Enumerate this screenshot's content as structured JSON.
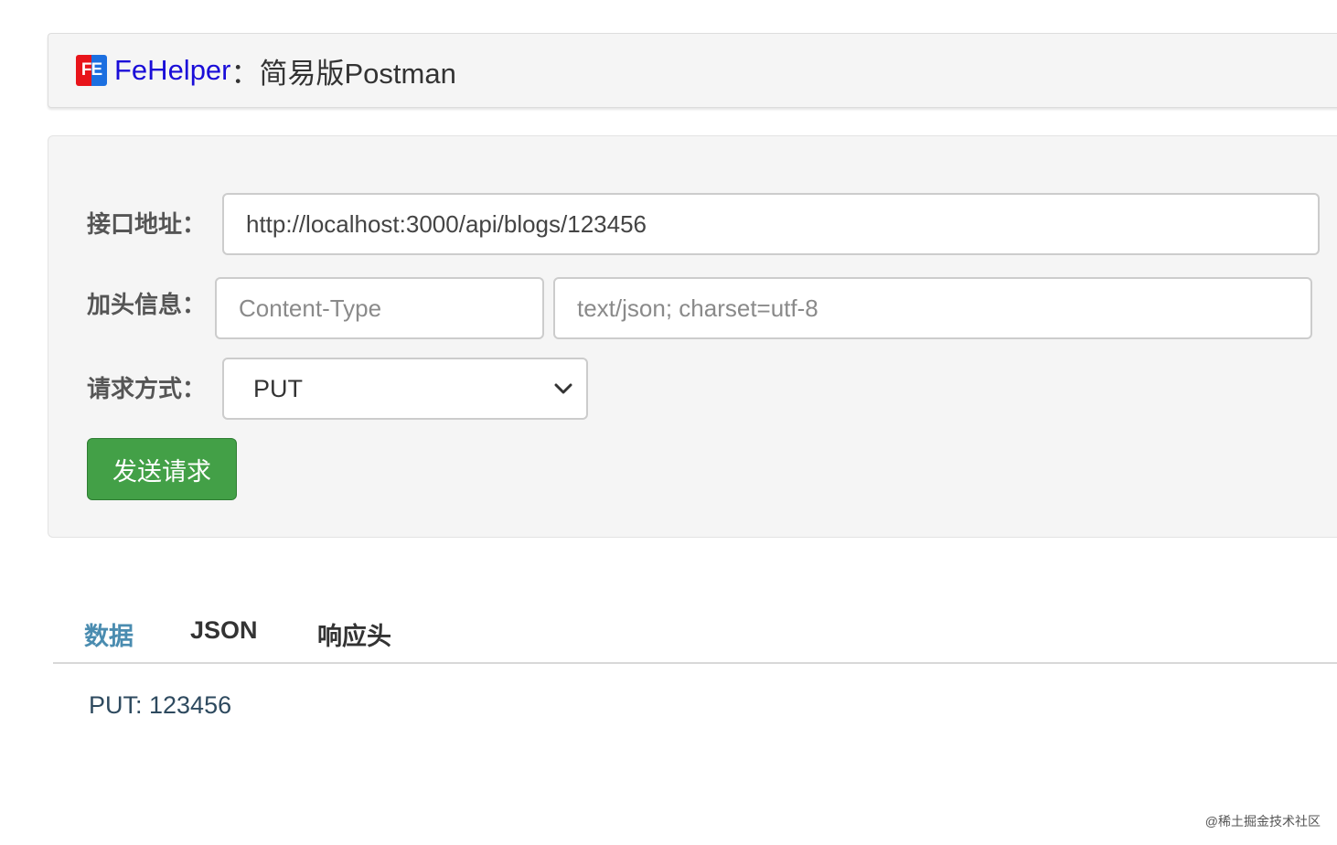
{
  "header": {
    "logo_text": "FE",
    "brand": "FeHelper",
    "separator": "：",
    "title": "简易版Postman"
  },
  "form": {
    "url_label": "接口地址：",
    "url_value": "http://localhost:3000/api/blogs/123456",
    "header_label": "加头信息：",
    "header_key_placeholder": "Content-Type",
    "header_value_placeholder": "text/json; charset=utf-8",
    "method_label": "请求方式：",
    "method_value": "PUT",
    "send_label": "发送请求"
  },
  "tabs": [
    {
      "label": "数据",
      "active": true
    },
    {
      "label": "JSON",
      "active": false
    },
    {
      "label": "响应头",
      "active": false
    }
  ],
  "result": {
    "text": "PUT: 123456"
  },
  "watermark": "@稀土掘金技术社区",
  "colors": {
    "brand": "#1a0dd8",
    "send_button": "#43a047",
    "active_tab": "#4a8cb0",
    "logo_red": "#e8141a",
    "logo_blue": "#1c6fe0"
  }
}
